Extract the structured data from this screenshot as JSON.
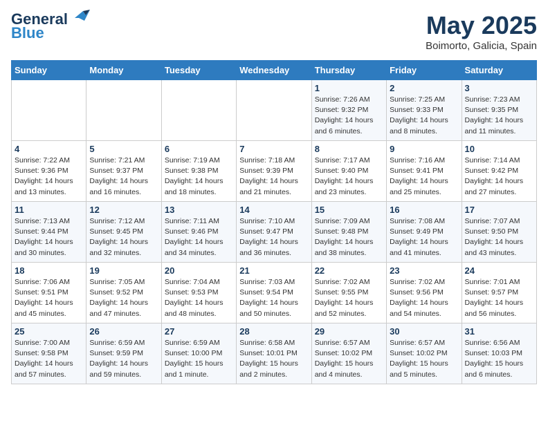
{
  "logo": {
    "line1": "General",
    "line2": "Blue"
  },
  "title": "May 2025",
  "subtitle": "Boimorto, Galicia, Spain",
  "header_days": [
    "Sunday",
    "Monday",
    "Tuesday",
    "Wednesday",
    "Thursday",
    "Friday",
    "Saturday"
  ],
  "weeks": [
    [
      {
        "day": "",
        "info": ""
      },
      {
        "day": "",
        "info": ""
      },
      {
        "day": "",
        "info": ""
      },
      {
        "day": "",
        "info": ""
      },
      {
        "day": "1",
        "info": "Sunrise: 7:26 AM\nSunset: 9:32 PM\nDaylight: 14 hours\nand 6 minutes."
      },
      {
        "day": "2",
        "info": "Sunrise: 7:25 AM\nSunset: 9:33 PM\nDaylight: 14 hours\nand 8 minutes."
      },
      {
        "day": "3",
        "info": "Sunrise: 7:23 AM\nSunset: 9:35 PM\nDaylight: 14 hours\nand 11 minutes."
      }
    ],
    [
      {
        "day": "4",
        "info": "Sunrise: 7:22 AM\nSunset: 9:36 PM\nDaylight: 14 hours\nand 13 minutes."
      },
      {
        "day": "5",
        "info": "Sunrise: 7:21 AM\nSunset: 9:37 PM\nDaylight: 14 hours\nand 16 minutes."
      },
      {
        "day": "6",
        "info": "Sunrise: 7:19 AM\nSunset: 9:38 PM\nDaylight: 14 hours\nand 18 minutes."
      },
      {
        "day": "7",
        "info": "Sunrise: 7:18 AM\nSunset: 9:39 PM\nDaylight: 14 hours\nand 21 minutes."
      },
      {
        "day": "8",
        "info": "Sunrise: 7:17 AM\nSunset: 9:40 PM\nDaylight: 14 hours\nand 23 minutes."
      },
      {
        "day": "9",
        "info": "Sunrise: 7:16 AM\nSunset: 9:41 PM\nDaylight: 14 hours\nand 25 minutes."
      },
      {
        "day": "10",
        "info": "Sunrise: 7:14 AM\nSunset: 9:42 PM\nDaylight: 14 hours\nand 27 minutes."
      }
    ],
    [
      {
        "day": "11",
        "info": "Sunrise: 7:13 AM\nSunset: 9:44 PM\nDaylight: 14 hours\nand 30 minutes."
      },
      {
        "day": "12",
        "info": "Sunrise: 7:12 AM\nSunset: 9:45 PM\nDaylight: 14 hours\nand 32 minutes."
      },
      {
        "day": "13",
        "info": "Sunrise: 7:11 AM\nSunset: 9:46 PM\nDaylight: 14 hours\nand 34 minutes."
      },
      {
        "day": "14",
        "info": "Sunrise: 7:10 AM\nSunset: 9:47 PM\nDaylight: 14 hours\nand 36 minutes."
      },
      {
        "day": "15",
        "info": "Sunrise: 7:09 AM\nSunset: 9:48 PM\nDaylight: 14 hours\nand 38 minutes."
      },
      {
        "day": "16",
        "info": "Sunrise: 7:08 AM\nSunset: 9:49 PM\nDaylight: 14 hours\nand 41 minutes."
      },
      {
        "day": "17",
        "info": "Sunrise: 7:07 AM\nSunset: 9:50 PM\nDaylight: 14 hours\nand 43 minutes."
      }
    ],
    [
      {
        "day": "18",
        "info": "Sunrise: 7:06 AM\nSunset: 9:51 PM\nDaylight: 14 hours\nand 45 minutes."
      },
      {
        "day": "19",
        "info": "Sunrise: 7:05 AM\nSunset: 9:52 PM\nDaylight: 14 hours\nand 47 minutes."
      },
      {
        "day": "20",
        "info": "Sunrise: 7:04 AM\nSunset: 9:53 PM\nDaylight: 14 hours\nand 48 minutes."
      },
      {
        "day": "21",
        "info": "Sunrise: 7:03 AM\nSunset: 9:54 PM\nDaylight: 14 hours\nand 50 minutes."
      },
      {
        "day": "22",
        "info": "Sunrise: 7:02 AM\nSunset: 9:55 PM\nDaylight: 14 hours\nand 52 minutes."
      },
      {
        "day": "23",
        "info": "Sunrise: 7:02 AM\nSunset: 9:56 PM\nDaylight: 14 hours\nand 54 minutes."
      },
      {
        "day": "24",
        "info": "Sunrise: 7:01 AM\nSunset: 9:57 PM\nDaylight: 14 hours\nand 56 minutes."
      }
    ],
    [
      {
        "day": "25",
        "info": "Sunrise: 7:00 AM\nSunset: 9:58 PM\nDaylight: 14 hours\nand 57 minutes."
      },
      {
        "day": "26",
        "info": "Sunrise: 6:59 AM\nSunset: 9:59 PM\nDaylight: 14 hours\nand 59 minutes."
      },
      {
        "day": "27",
        "info": "Sunrise: 6:59 AM\nSunset: 10:00 PM\nDaylight: 15 hours\nand 1 minute."
      },
      {
        "day": "28",
        "info": "Sunrise: 6:58 AM\nSunset: 10:01 PM\nDaylight: 15 hours\nand 2 minutes."
      },
      {
        "day": "29",
        "info": "Sunrise: 6:57 AM\nSunset: 10:02 PM\nDaylight: 15 hours\nand 4 minutes."
      },
      {
        "day": "30",
        "info": "Sunrise: 6:57 AM\nSunset: 10:02 PM\nDaylight: 15 hours\nand 5 minutes."
      },
      {
        "day": "31",
        "info": "Sunrise: 6:56 AM\nSunset: 10:03 PM\nDaylight: 15 hours\nand 6 minutes."
      }
    ]
  ]
}
